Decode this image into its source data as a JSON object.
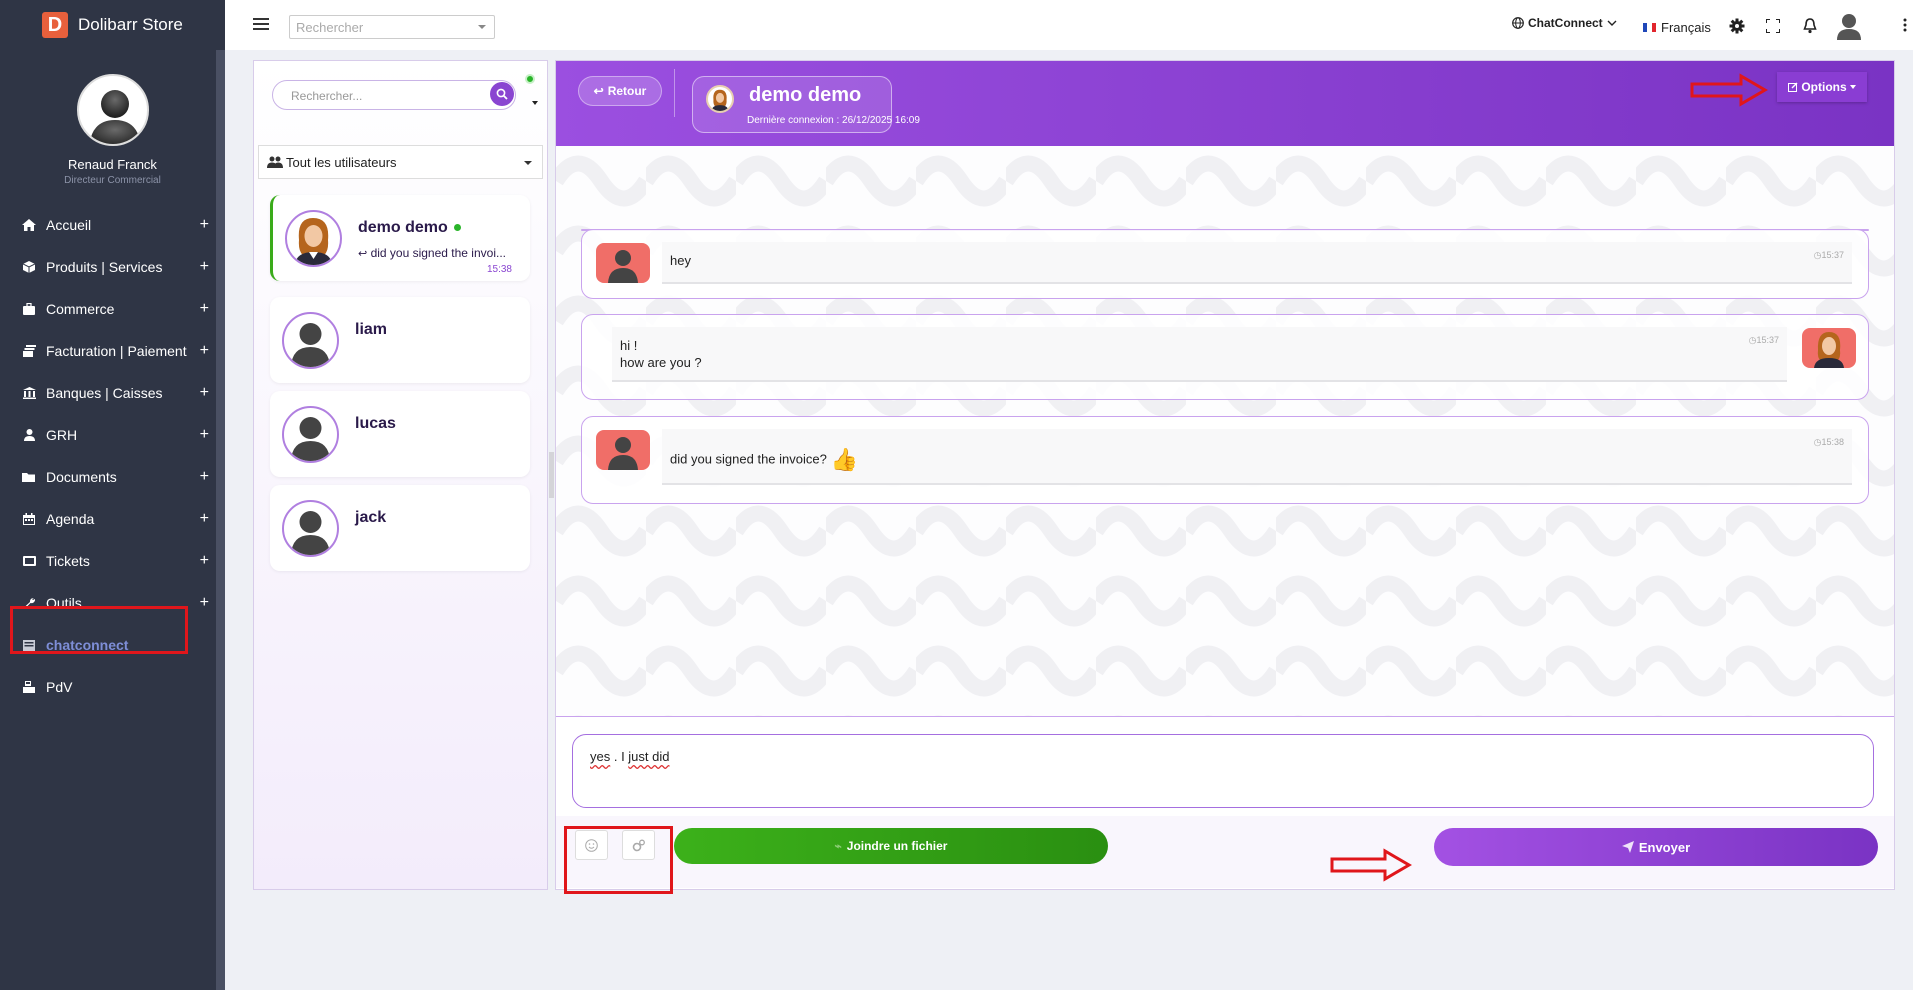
{
  "app": {
    "brand_letter": "D",
    "brand_name": "Dolibarr Store"
  },
  "user": {
    "name": "Renaud Franck",
    "role": "Directeur Commercial"
  },
  "sidebar": {
    "items": [
      {
        "label": "Accueil",
        "icon": "home-icon",
        "expandable": true
      },
      {
        "label": "Produits | Services",
        "icon": "cube-icon",
        "expandable": true
      },
      {
        "label": "Commerce",
        "icon": "suitcase-icon",
        "expandable": true
      },
      {
        "label": "Facturation | Paiement",
        "icon": "money-icon",
        "expandable": true
      },
      {
        "label": "Banques | Caisses",
        "icon": "bank-icon",
        "expandable": true
      },
      {
        "label": "GRH",
        "icon": "person-icon",
        "expandable": true
      },
      {
        "label": "Documents",
        "icon": "folder-icon",
        "expandable": true
      },
      {
        "label": "Agenda",
        "icon": "calendar-icon",
        "expandable": true
      },
      {
        "label": "Tickets",
        "icon": "ticket-icon",
        "expandable": true
      },
      {
        "label": "Outils",
        "icon": "wrench-icon",
        "expandable": true
      },
      {
        "label": "chatconnect",
        "icon": "chat-icon",
        "expandable": false,
        "active": true
      },
      {
        "label": "PdV",
        "icon": "cash-register-icon",
        "expandable": false
      }
    ],
    "expand_symbol": "+"
  },
  "topbar": {
    "search_placeholder": "Rechercher",
    "module_menu": "ChatConnect",
    "language": "Français"
  },
  "users_panel": {
    "search_placeholder": "Rechercher...",
    "filter": "Tout les utilisateurs",
    "users": [
      {
        "name": "demo demo",
        "online": true,
        "last_message": "did you signed the invoi...",
        "time": "15:38",
        "active": true
      },
      {
        "name": "liam",
        "online": false,
        "last_message": "",
        "time": ""
      },
      {
        "name": "lucas",
        "online": false,
        "last_message": "",
        "time": ""
      },
      {
        "name": "jack",
        "online": false,
        "last_message": "",
        "time": ""
      }
    ]
  },
  "chat": {
    "back_label": "Retour",
    "contact_name": "demo demo",
    "last_connection": "Dernière connexion : 26/12/2025 16:09",
    "options_label": "Options",
    "messages": [
      {
        "from": "me",
        "lines": [
          "hey"
        ],
        "time": "15:37"
      },
      {
        "from": "other",
        "lines": [
          "hi !",
          "how are you ?"
        ],
        "time": "15:37"
      },
      {
        "from": "me",
        "lines": [
          "did you signed the invoice?"
        ],
        "emoji": "👍",
        "time": "15:38"
      }
    ],
    "composer_value_1": "yes",
    "composer_value_2": " . I ",
    "composer_value_3": "just did",
    "attach_label": "Joindre un fichier",
    "send_label": "Envoyer"
  },
  "colors": {
    "sidebar_bg": "#2f3545",
    "accent_purple": "#8a3dd3",
    "attach_green": "#3cb11a",
    "highlight_red": "#e0161b"
  }
}
